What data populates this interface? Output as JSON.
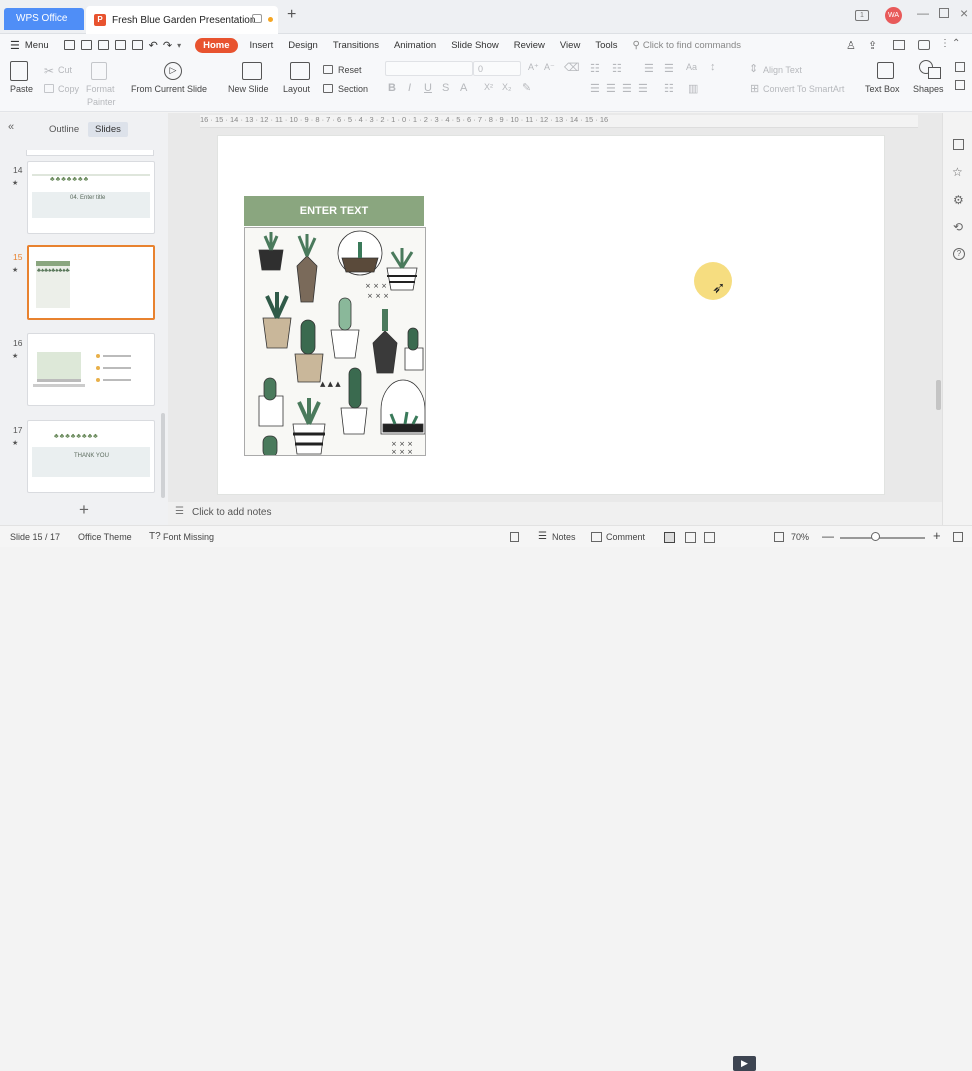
{
  "tabs": {
    "app": "WPS Office",
    "doc": "Fresh Blue Garden Presentation",
    "user_initials": "WA"
  },
  "menu": {
    "label": "Menu",
    "items": [
      "Home",
      "Insert",
      "Design",
      "Transitions",
      "Animation",
      "Slide Show",
      "Review",
      "View",
      "Tools"
    ],
    "search": "Click to find commands"
  },
  "ribbon": {
    "paste": "Paste",
    "cut": "Cut",
    "copy": "Copy",
    "format_painter_1": "Format",
    "format_painter_2": "Painter",
    "from_current": "From Current Slide",
    "new_slide": "New Slide",
    "layout": "Layout",
    "reset": "Reset",
    "section": "Section",
    "font_size": "0",
    "align_text": "Align Text",
    "convert_smartart": "Convert To SmartArt",
    "text_box": "Text Box",
    "shapes": "Shapes"
  },
  "panel": {
    "outline": "Outline",
    "slides": "Slides"
  },
  "thumbs": [
    {
      "num": "14",
      "title": "04. Enter title"
    },
    {
      "num": "15",
      "label": "ENTER TEXT"
    },
    {
      "num": "16"
    },
    {
      "num": "17",
      "title": "THANK YOU"
    }
  ],
  "ruler": "16 · 15 · 14 · 13 · 12 · 11 · 10 · 9 · 8 · 7 · 6 · 5 · 4 · 3 · 2 · 1 · 0 · 1 · 2 · 3 · 4 · 5 · 6 · 7 · 8 · 9 · 10 · 11 · 12 · 13 · 14 · 15 · 16",
  "slide": {
    "header": "ENTER TEXT"
  },
  "notes": "Click to add notes",
  "status": {
    "slide": "Slide 15 / 17",
    "theme": "Office Theme",
    "font_missing": "Font Missing",
    "notes": "Notes",
    "comment": "Comment",
    "zoom": "70%"
  },
  "colors": {
    "accent": "#e8532f",
    "wps_blue": "#4f8ef7",
    "sage": "#8aa67f",
    "selection": "#e8822f"
  }
}
